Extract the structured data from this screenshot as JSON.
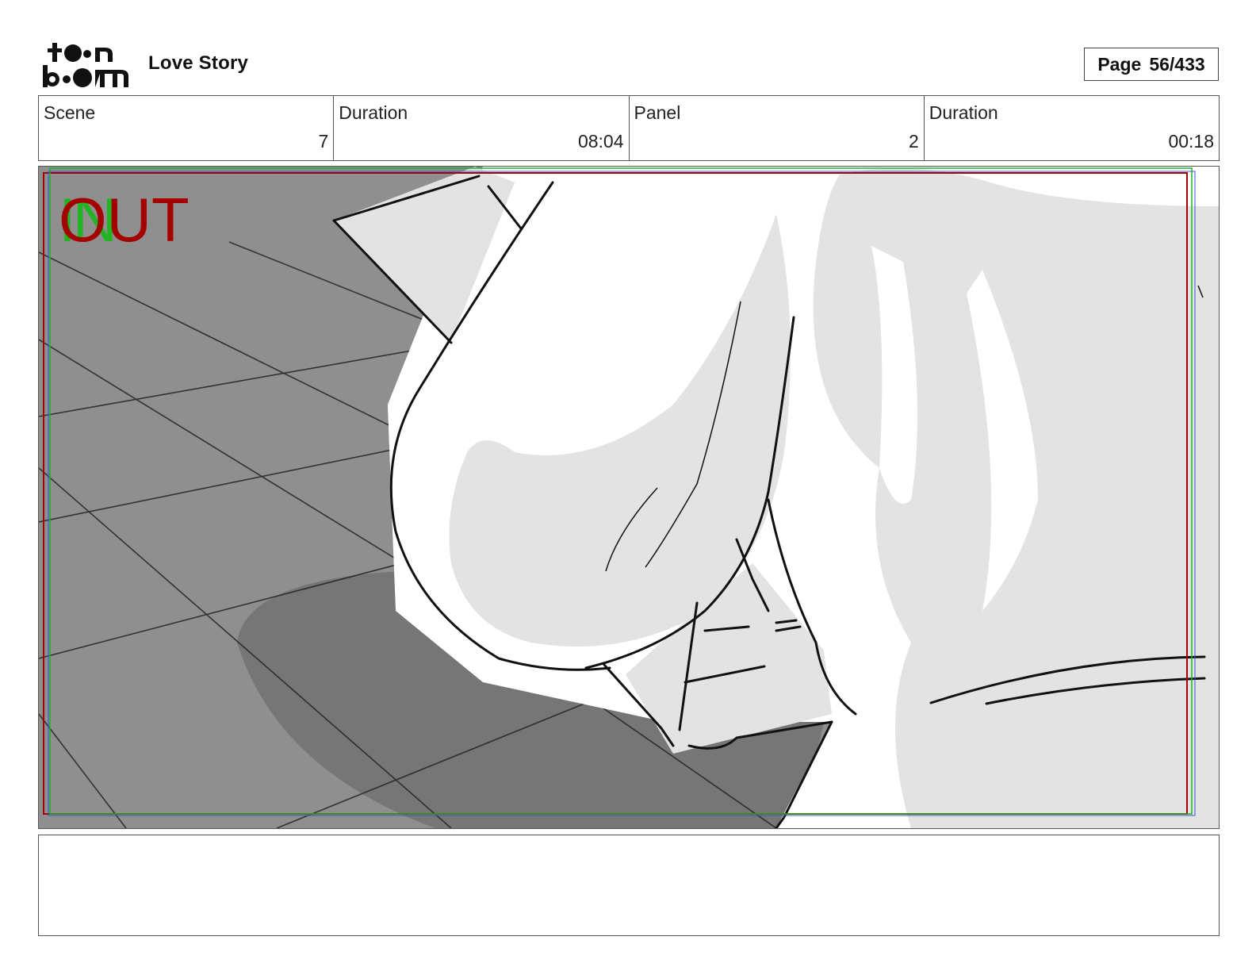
{
  "header": {
    "logo_text": "toonboom",
    "project_title": "Love Story",
    "page_label": "Page",
    "page_number": "56/433"
  },
  "info": {
    "scene_label": "Scene",
    "scene_value": "7",
    "scene_duration_label": "Duration",
    "scene_duration_value": "08:04",
    "panel_label": "Panel",
    "panel_value": "2",
    "panel_duration_label": "Duration",
    "panel_duration_value": "00:18"
  },
  "panel": {
    "in_marker": "IN",
    "out_marker": "OUT",
    "colors": {
      "in": "#22b422",
      "out": "#a40000",
      "floor": "#8f8f8f",
      "shadow": "#737373",
      "fill": "#e3e3e3"
    }
  },
  "notes": {
    "text": ""
  }
}
